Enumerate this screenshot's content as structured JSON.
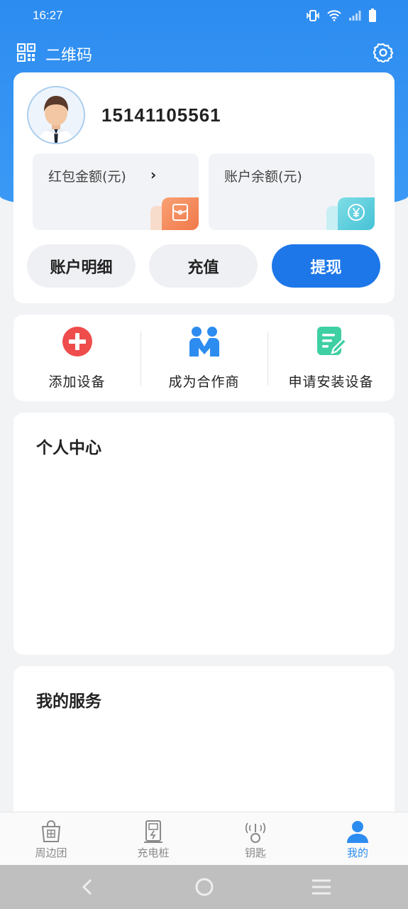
{
  "status_bar": {
    "time": "16:27"
  },
  "header": {
    "qr_label": "二维码"
  },
  "profile": {
    "phone": "15141105561"
  },
  "wallet": {
    "red_packet_label": "红包金额(元)",
    "balance_label": "账户余额(元)"
  },
  "buttons": {
    "details": "账户明细",
    "recharge": "充值",
    "withdraw": "提现"
  },
  "actions": [
    {
      "label": "添加设备",
      "icon": "add-circle-icon"
    },
    {
      "label": "成为合作商",
      "icon": "partner-icon"
    },
    {
      "label": "申请安装设备",
      "icon": "apply-edit-icon"
    }
  ],
  "sections": {
    "personal_center": "个人中心",
    "my_services": "我的服务"
  },
  "tabs": [
    {
      "label": "周边团",
      "icon": "shopping-bag-icon"
    },
    {
      "label": "充电桩",
      "icon": "charging-pile-icon"
    },
    {
      "label": "钥匙",
      "icon": "key-signal-icon"
    },
    {
      "label": "我的",
      "icon": "user-icon"
    }
  ],
  "colors": {
    "primary": "#2d8cf0",
    "button_blue": "#1e77e8",
    "add_red": "#ef4c4c",
    "partner_blue": "#2d8cf0",
    "apply_teal": "#3ecfa3"
  }
}
